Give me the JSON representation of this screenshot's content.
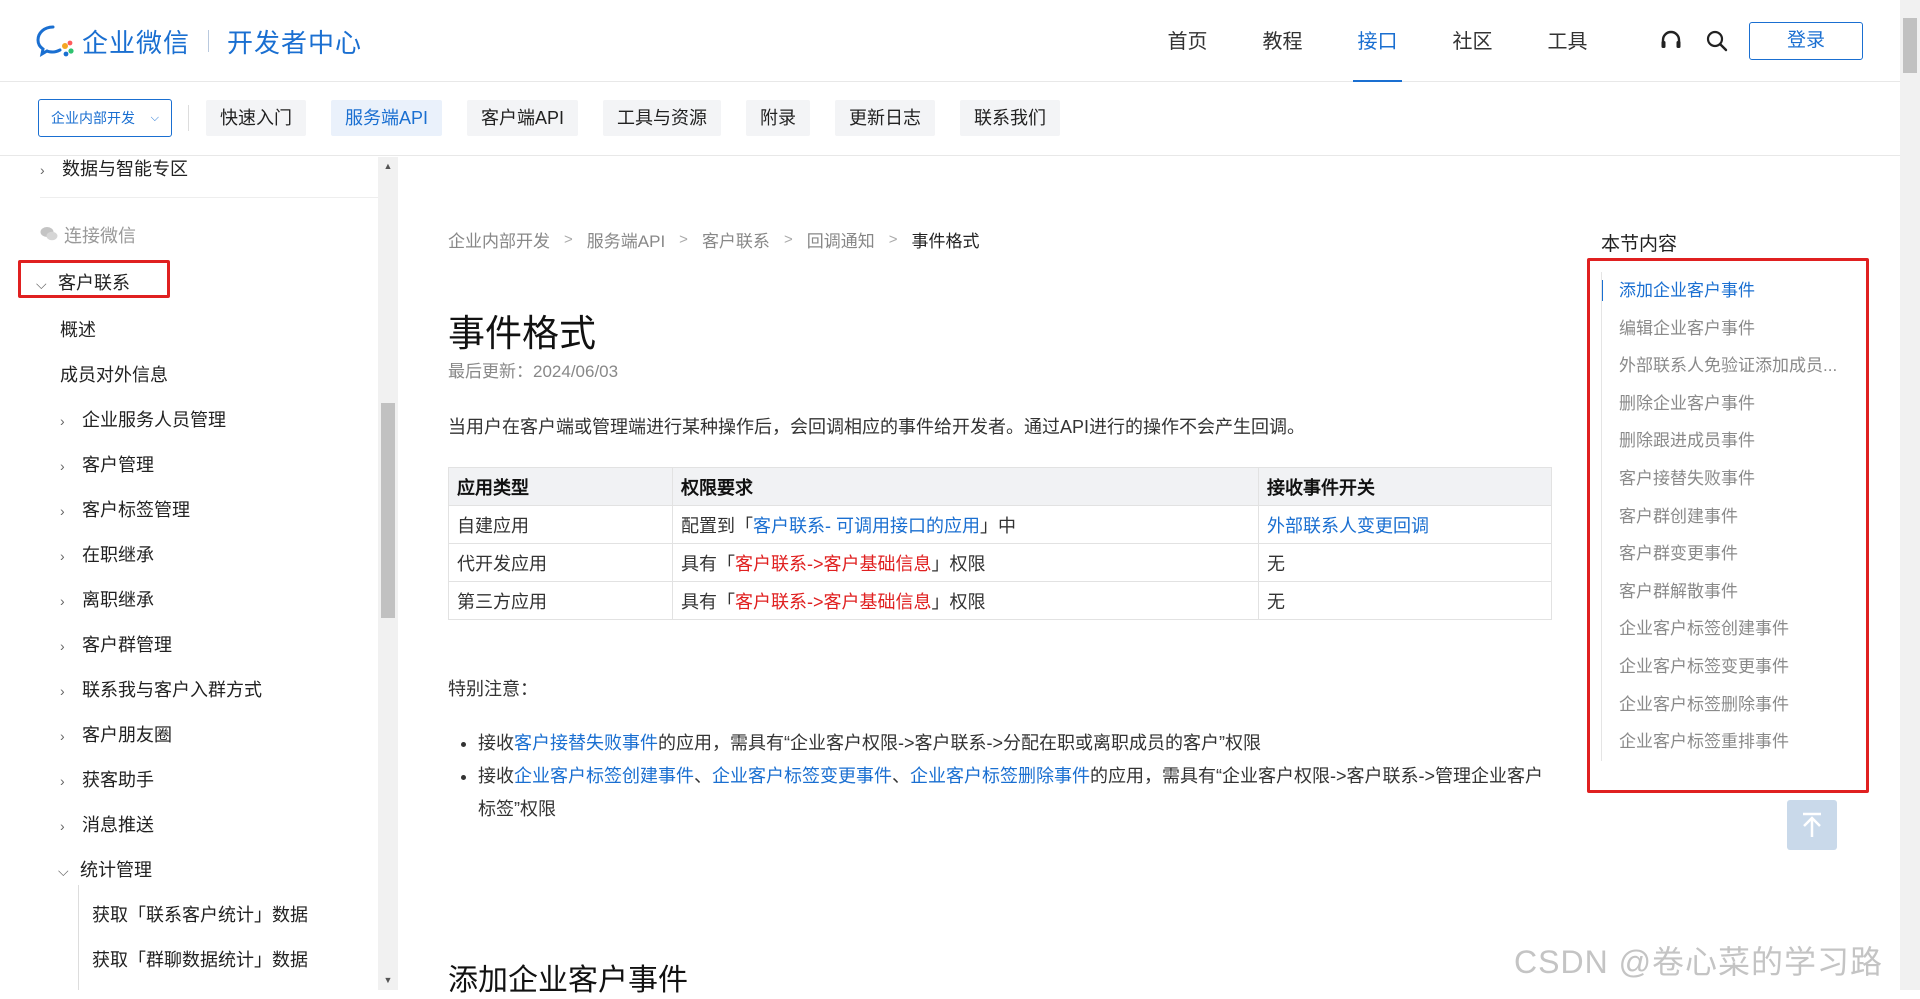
{
  "brand": {
    "name": "企业微信",
    "product": "开发者中心"
  },
  "main_nav": [
    {
      "label": "首页",
      "active": false
    },
    {
      "label": "教程",
      "active": false
    },
    {
      "label": "接口",
      "active": true
    },
    {
      "label": "社区",
      "active": false
    },
    {
      "label": "工具",
      "active": false
    }
  ],
  "header_icons": [
    "headset-icon",
    "search-icon"
  ],
  "login_label": "登录",
  "scope_select": {
    "value": "企业内部开发"
  },
  "sub_tabs": [
    {
      "label": "快速入门",
      "active": false
    },
    {
      "label": "服务端API",
      "active": true
    },
    {
      "label": "客户端API",
      "active": false
    },
    {
      "label": "工具与资源",
      "active": false
    },
    {
      "label": "附录",
      "active": false
    },
    {
      "label": "更新日志",
      "active": false
    },
    {
      "label": "联系我们",
      "active": false
    }
  ],
  "sidebar": {
    "data_zone": "数据与智能专区",
    "section_label": "连接微信",
    "current_group": "客户联系",
    "leaf_items": [
      "概述",
      "成员对外信息"
    ],
    "groups": [
      "企业服务人员管理",
      "客户管理",
      "客户标签管理",
      "在职继承",
      "离职继承",
      "客户群管理",
      "联系我与客户入群方式",
      "客户朋友圈",
      "获客助手",
      "消息推送"
    ],
    "expanded_group": "统计管理",
    "sub_items": [
      "获取「联系客户统计」数据",
      "获取「群聊数据统计」数据"
    ]
  },
  "breadcrumb": [
    "企业内部开发",
    "服务端API",
    "客户联系",
    "回调通知",
    "事件格式"
  ],
  "page": {
    "title": "事件格式",
    "updated": "最后更新：2024/06/03",
    "intro": "当用户在客户端或管理端进行某种操作后，会回调相应的事件给开发者。通过API进行的操作不会产生回调。"
  },
  "table": {
    "headers": [
      "应用类型",
      "权限要求",
      "接收事件开关"
    ],
    "rows": [
      {
        "type": "自建应用",
        "req_prefix": "配置到「",
        "req_link": "客户联系- 可调用接口的应用",
        "req_suffix": "」中",
        "switch": "外部联系人变更回调",
        "switch_is_link": true
      },
      {
        "type": "代开发应用",
        "req_prefix": "具有「",
        "req_link": "客户联系->客户基础信息",
        "req_suffix": "」权限",
        "switch": "无",
        "switch_is_link": false
      },
      {
        "type": "第三方应用",
        "req_prefix": "具有「",
        "req_link": "客户联系->客户基础信息",
        "req_suffix": "」权限",
        "switch": "无",
        "switch_is_link": false
      }
    ]
  },
  "note_title": "特别注意：",
  "bullets": {
    "b1_prefix": "接收",
    "b1_link": "客户接替失败事件",
    "b1_suffix": "的应用，需具有“企业客户权限->客户联系->分配在职或离职成员的客户”权限",
    "b2_prefix": "接收",
    "b2_link1": "企业客户标签创建事件",
    "sep": "、",
    "b2_link2": "企业客户标签变更事件",
    "b2_link3": "企业客户标签删除事件",
    "b2_suffix": "的应用，需具有“企业客户权限->客户联系->管理企业客户标签”权限"
  },
  "section_heading": "添加企业客户事件",
  "toc": {
    "title": "本节内容",
    "items": [
      "添加企业客户事件",
      "编辑企业客户事件",
      "外部联系人免验证添加成员...",
      "删除企业客户事件",
      "删除跟进成员事件",
      "客户接替失败事件",
      "客户群创建事件",
      "客户群变更事件",
      "客户群解散事件",
      "企业客户标签创建事件",
      "企业客户标签变更事件",
      "企业客户标签删除事件",
      "企业客户标签重排事件"
    ],
    "active_index": 0
  },
  "watermark": "CSDN @卷心菜的学习路",
  "colors": {
    "accent": "#1a6fd1",
    "highlight_red": "#e02020"
  }
}
